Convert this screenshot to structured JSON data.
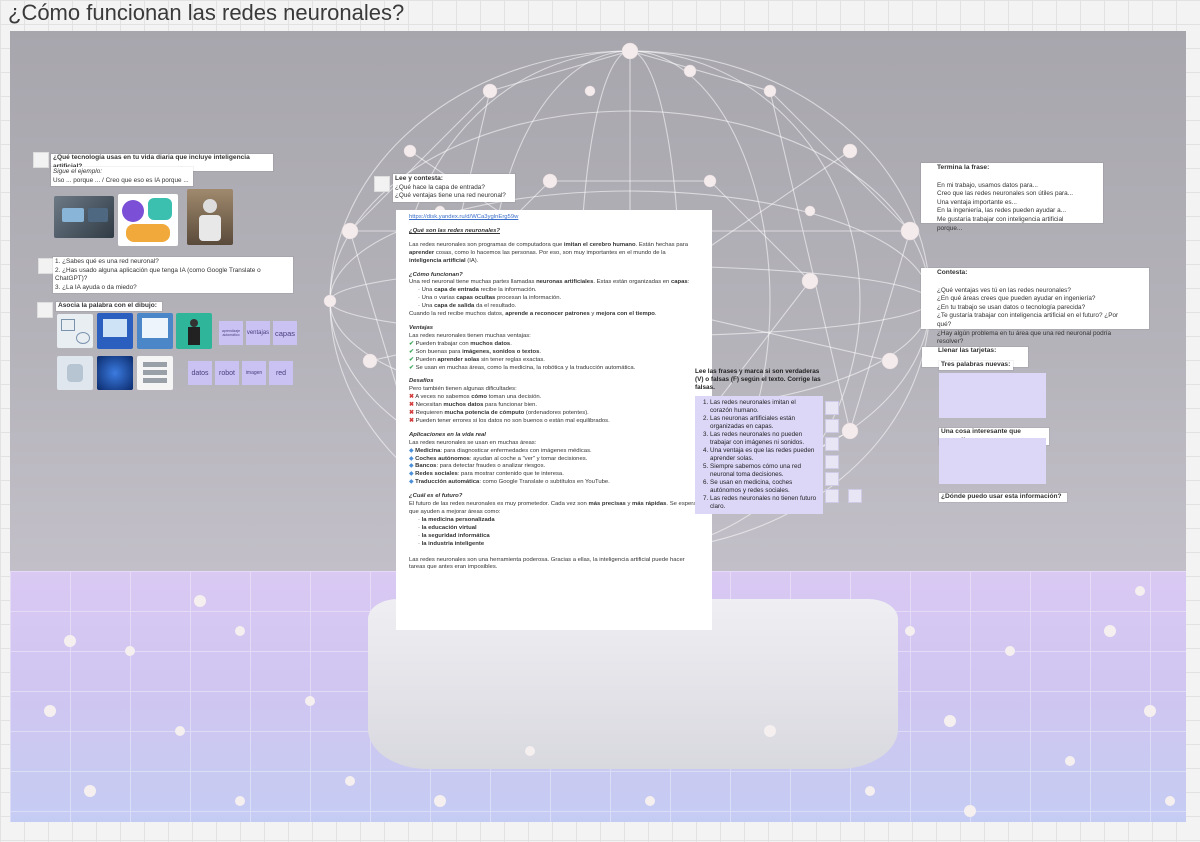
{
  "board": {
    "title": "¿Cómo funcionan las redes neuronales?"
  },
  "q_tech": {
    "question": "¿Qué tecnología usas en tu vida diaria que incluye inteligencia artificial?",
    "example_label": "Sigue el ejemplo:",
    "example": "Uso ... porque ... / Creo que eso es IA porque ..."
  },
  "q_list": {
    "items": [
      "1. ¿Sabes qué es una red neuronal?",
      "2. ¿Has usado alguna aplicación que tenga IA (como Google Translate o ChatGPT)?",
      "3. ¿La IA ayuda o da miedo?"
    ]
  },
  "assoc": {
    "title": "Asocia la palabra con el dibujo:",
    "words": [
      "aprendizaje automático",
      "ventajas",
      "capas",
      "datos",
      "robot",
      "imagen",
      "red"
    ]
  },
  "read": {
    "title": "Lee y contesta:",
    "q1": "¿Qué hace la capa de entrada?",
    "q2": "¿Qué ventajas tiene una red neuronal?"
  },
  "article": {
    "link": "https://disk.yandex.ru/d/WCa3yglnErg59w",
    "s1_title": "¿Qué son las redes neuronales?",
    "s1_a": "Las redes neuronales son programas de computadora que",
    "s1_b": "imitan el cerebro humano",
    "s1_c": ". Están hechas para",
    "s1_d": "aprender",
    "s1_e": "cosas, como lo hacemos las personas. Por eso, son muy importantes en el mundo de la",
    "s1_f": "inteligencia artificial",
    "s1_g": "(IA).",
    "s2_title": "¿Cómo funcionan?",
    "s2_a": "Una red neuronal tiene muchas partes llamadas",
    "s2_b": "neuronas artificiales",
    "s2_c": ". Estas están organizadas en",
    "s2_d": "capas",
    "s2_e": ":",
    "s2_l1a": "Una",
    "s2_l1b": "capa de entrada",
    "s2_l1c": "recibe la información.",
    "s2_l2a": "Una o varias",
    "s2_l2b": "capas ocultas",
    "s2_l2c": "procesan la información.",
    "s2_l3a": "Una",
    "s2_l3b": "capa de salida",
    "s2_l3c": "da el resultado.",
    "s2_f": "Cuando la red recibe muchos datos,",
    "s2_g": "aprende a reconocer patrones",
    "s2_h": "y",
    "s2_i": "mejora con el tiempo",
    "s3_title": "Ventajas",
    "s3_intro": "Las redes neuronales tienen muchas ventajas:",
    "s3_v1a": "Pueden trabajar con",
    "s3_v1b": "muchos datos",
    "s3_v2a": "Son buenas para",
    "s3_v2b": "imágenes, sonidos o textos",
    "s3_v3a": "Pueden",
    "s3_v3b": "aprender solas",
    "s3_v3c": "sin tener reglas exactas.",
    "s3_v4": "Se usan en muchas áreas, como la medicina, la robótica y la traducción automática.",
    "s4_title": "Desafíos",
    "s4_intro": "Pero también tienen algunas dificultades:",
    "s4_d1a": "A veces no sabemos",
    "s4_d1b": "cómo",
    "s4_d1c": "toman una decisión.",
    "s4_d2a": "Necesitan",
    "s4_d2b": "muchos datos",
    "s4_d2c": "para funcionar bien.",
    "s4_d3a": "Requieren",
    "s4_d3b": "mucha potencia de cómputo",
    "s4_d3c": "(ordenadores potentes).",
    "s4_d4": "Pueden tener errores si los datos no son buenos o están mal equilibrados.",
    "s5_title": "Aplicaciones en la vida real",
    "s5_intro": "Las redes neuronales se usan en muchas áreas:",
    "s5_a1b": "Medicina",
    "s5_a1c": ": para diagnosticar enfermedades con imágenes médicas.",
    "s5_a2b": "Coches autónomos",
    "s5_a2c": ": ayudan al coche a \"ver\" y tomar decisiones.",
    "s5_a3b": "Bancos",
    "s5_a3c": ": para detectar fraudes o analizar riesgos.",
    "s5_a4b": "Redes sociales",
    "s5_a4c": ": para mostrar contenido que te interesa.",
    "s5_a5b": "Traducción automática",
    "s5_a5c": ": como Google Translate o subtítulos en YouTube.",
    "s6_title": "¿Cuál es el futuro?",
    "s6_a": "El futuro de las redes neuronales es muy prometedor. Cada vez son",
    "s6_b": "más precisas",
    "s6_c": "y",
    "s6_d": "más rápidas",
    "s6_e": ". Se espera que ayuden a mejorar áreas como:",
    "s6_l1": "la medicina personalizada",
    "s6_l2": "la educación virtual",
    "s6_l3": "la seguridad informática",
    "s6_l4": "la industria inteligente",
    "s6_end": "Las redes neuronales son una herramienta poderosa. Gracias a ellas, la inteligencia artificial puede hacer tareas que antes eran imposibles."
  },
  "tf": {
    "title": "Lee las frases y marca si son verdaderas (V) o falsas (F) según el texto. Corrige las falsas.",
    "items": [
      "Las redes neuronales imitan el corazón humano.",
      "Las neuronas artificiales están organizadas en capas.",
      "Las redes neuronales no pueden trabajar con imágenes ni sonidos.",
      "Una ventaja es que las redes pueden aprender solas.",
      "Siempre sabemos cómo una red neuronal toma decisiones.",
      "Se usan en medicina, coches autónomos y redes sociales.",
      "Las redes neuronales no tienen futuro claro."
    ]
  },
  "finish": {
    "title": "Termina la frase:",
    "lines": [
      "En mi trabajo, usamos datos para...",
      "Creo que las redes neuronales son útiles para...",
      "Una ventaja importante es...",
      "En la ingeniería, las redes pueden ayudar a...",
      "Me gustaría trabajar con inteligencia artificial porque..."
    ]
  },
  "answer": {
    "title": "Contesta:",
    "lines": [
      "¿Qué ventajas ves tú en las redes neuronales?",
      "¿En qué áreas crees que pueden ayudar en ingeniería?",
      "¿En tu trabajo se usan datos o tecnología parecida?",
      "¿Te gustaría trabajar con inteligencia artificial en el futuro? ¿Por qué?",
      "¿Hay algún problema en tu área que una red neuronal podría resolver?"
    ]
  },
  "cards": {
    "title": "Llenar las tarjetas:",
    "c1": "Tres palabras nuevas:",
    "c2": "Una cosa interesante que aprendí:",
    "c3": "¿Dónde puedo usar esta información?"
  }
}
